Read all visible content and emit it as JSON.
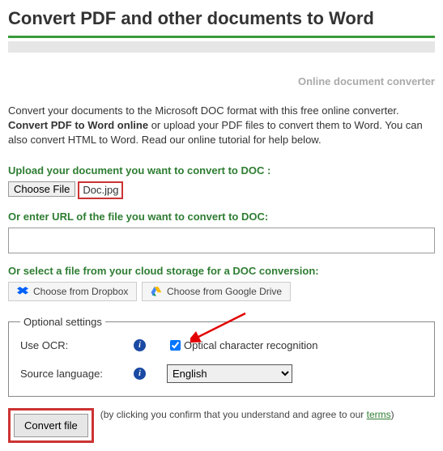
{
  "title": "Convert PDF and other documents to Word",
  "subhead": "Online document converter",
  "intro_pre": "Convert your documents to the Microsoft DOC format with this free online converter. ",
  "intro_bold": "Convert PDF to Word online",
  "intro_post": " or upload your PDF files to convert them to Word. You can also convert HTML to Word. Read our online tutorial for help below.",
  "upload_heading": "Upload your document you want to convert to DOC :",
  "choose_file_label": "Choose File",
  "selected_file": "Doc.jpg",
  "url_heading": "Or enter URL of the file you want to convert to DOC:",
  "url_value": "",
  "cloud_heading": "Or select a file from your cloud storage for a DOC conversion:",
  "cloud_dropbox": "Choose from Dropbox",
  "cloud_gdrive": "Choose from Google Drive",
  "optional_legend": "Optional settings",
  "ocr_label": "Use OCR:",
  "ocr_text": "Optical character recognition",
  "ocr_checked": true,
  "lang_label": "Source language:",
  "lang_value": "English",
  "convert_label": "Convert file",
  "fineprint_pre": "(by clicking you confirm that you understand and agree to our ",
  "fineprint_link": "terms",
  "fineprint_post": ")"
}
